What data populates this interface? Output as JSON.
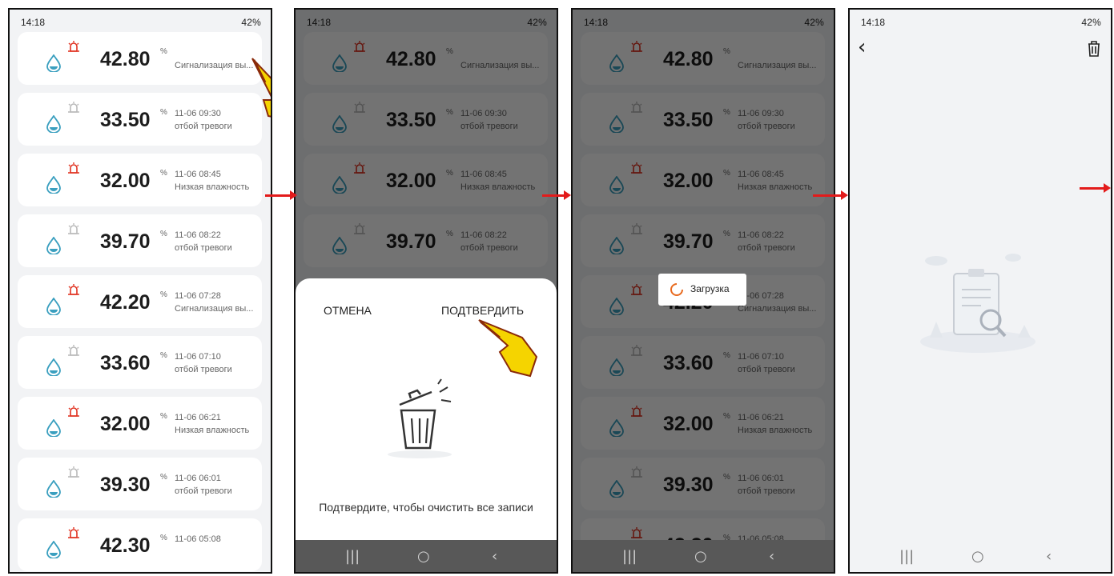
{
  "status": {
    "time": "14:18",
    "right": "42%"
  },
  "records": [
    {
      "value": "42.80",
      "date": "",
      "label": "Сигнализация вы...",
      "alarm": "red"
    },
    {
      "value": "33.50",
      "date": "11-06 09:30",
      "label": "отбой тревоги",
      "alarm": "gray"
    },
    {
      "value": "32.00",
      "date": "11-06 08:45",
      "label": "Низкая влажность",
      "alarm": "red"
    },
    {
      "value": "39.70",
      "date": "11-06 08:22",
      "label": "отбой тревоги",
      "alarm": "gray"
    },
    {
      "value": "42.20",
      "date": "11-06 07:28",
      "label": "Сигнализация вы...",
      "alarm": "red"
    },
    {
      "value": "33.60",
      "date": "11-06 07:10",
      "label": "отбой тревоги",
      "alarm": "gray"
    },
    {
      "value": "32.00",
      "date": "11-06 06:21",
      "label": "Низкая влажность",
      "alarm": "red"
    },
    {
      "value": "39.30",
      "date": "11-06 06:01",
      "label": "отбой тревоги",
      "alarm": "gray"
    },
    {
      "value": "42.30",
      "date": "11-06 05:08",
      "label": "",
      "alarm": "red"
    }
  ],
  "unit": "%",
  "dialog": {
    "cancel": "ОТМЕНА",
    "confirm": "ПОДТВЕРДИТЬ",
    "message": "Подтвердите, чтобы очистить все записи"
  },
  "loading": "Загрузка",
  "colors": {
    "accent": "#3a9fbf",
    "alarm": "#e0301e",
    "arrow": "#e31b1b",
    "pointer": "#f5d400"
  },
  "icons": {
    "back": "chevron-left-icon",
    "trash": "trash-icon",
    "drop": "water-drop-icon",
    "alarm": "siren-icon"
  }
}
